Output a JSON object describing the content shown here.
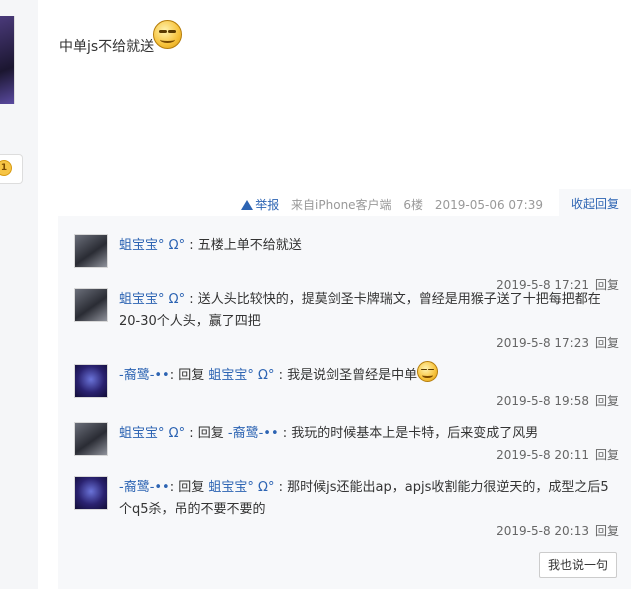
{
  "post": {
    "text": "中单js不给就送"
  },
  "left": {
    "badge": "1"
  },
  "meta": {
    "report": "举报",
    "client": "来自iPhone客户端",
    "floor": "6楼",
    "datetime": "2019-05-06 07:39",
    "collapse": "收起回复"
  },
  "replies": [
    {
      "user": "蛆宝宝° Ω°",
      "sep": ":",
      "reply_to": "",
      "reply_to_user": "",
      "text": "五楼上单不给就送",
      "time": "2019-5-8 17:21",
      "reply_label": "回复"
    },
    {
      "user": "蛆宝宝° Ω°",
      "sep": ":",
      "reply_to": "",
      "reply_to_user": "",
      "text": "送人头比较快的，提莫剑圣卡牌瑞文，曾经是用猴子送了十把每把都在20-30个人头，赢了四把",
      "time": "2019-5-8 17:23",
      "reply_label": "回复"
    },
    {
      "user": "-裔鹭-••",
      "sep": ":",
      "reply_to": "回复",
      "reply_to_user": "蛆宝宝° Ω°",
      "text": "我是说剑圣曾经是中单",
      "time": "2019-5-8 19:58",
      "reply_label": "回复"
    },
    {
      "user": "蛆宝宝° Ω°",
      "sep": ":",
      "reply_to": "回复",
      "reply_to_user": "-裔鹭-••",
      "text": "我玩的时候基本上是卡特，后来变成了风男",
      "time": "2019-5-8 20:11",
      "reply_label": "回复"
    },
    {
      "user": "-裔鹭-••",
      "sep": ":",
      "reply_to": "回复",
      "reply_to_user": "蛆宝宝° Ω°",
      "text": "那时候js还能出ap，apjs收割能力很逆天的，成型之后5个q5杀，吊的不要不要的",
      "time": "2019-5-8 20:13",
      "reply_label": "回复"
    }
  ],
  "say_button": "我也说一句"
}
